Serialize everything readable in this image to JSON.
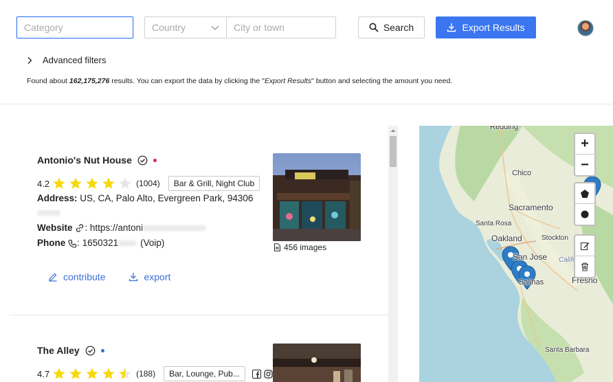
{
  "search": {
    "category_placeholder": "Category",
    "country_placeholder": "Country",
    "city_placeholder": "City or town",
    "search_label": "Search",
    "export_label": "Export Results"
  },
  "filters": {
    "advanced_label": "Advanced filters"
  },
  "summary": {
    "prefix": "Found about ",
    "count": "162,175,276",
    "middle": " results. You can export the data by clicking the \"",
    "button_ref": "Export Results",
    "suffix": "\" button and selecting the amount you need."
  },
  "results": [
    {
      "name": "Antonio's Nut House",
      "status_color": "#e0245e",
      "rating": "4.2",
      "rating_value": 4.2,
      "reviews": "(1004)",
      "category": "Bar & Grill, Night Club",
      "address_label": "Address:",
      "address": "US, CA, Palo Alto, Evergreen Park, 94306",
      "website_label": "Website",
      "website": "https://antoni",
      "phone_label": "Phone",
      "phone": "1650321",
      "phone_type": "(Voip)",
      "images": "456 images",
      "contribute_label": "contribute",
      "export_label": "export"
    },
    {
      "name": "The Alley",
      "status_color": "#2f6fe0",
      "rating": "4.7",
      "rating_value": 4.5,
      "reviews": "(188)",
      "category": "Bar, Lounge, Pub..."
    }
  ],
  "map": {
    "zoom_in": "+",
    "zoom_out": "−",
    "labels": [
      "Redding",
      "Chico",
      "Sacramento",
      "Santa Rosa",
      "Oakland",
      "Stockton",
      "San Jose",
      "Salinas",
      "Fresno",
      "California",
      "Santa Barbara"
    ]
  },
  "colors": {
    "accent": "#3b76f0",
    "star": "#f5d90a",
    "link": "#3b6fd8"
  }
}
